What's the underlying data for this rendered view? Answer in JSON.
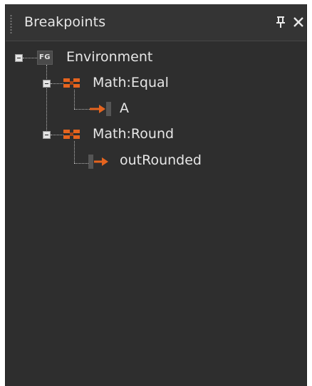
{
  "panel": {
    "title": "Breakpoints",
    "pin_glyph": "ф",
    "close_glyph": "✕"
  },
  "tree": {
    "root": {
      "icon": "flowgraph-icon",
      "icon_text": "FG",
      "label": "Environment",
      "expanded": true
    },
    "nodes": [
      {
        "icon": "node-icon",
        "label": "Math:Equal",
        "expanded": true,
        "ports": [
          {
            "icon": "input-port-arrow-icon",
            "label": "A"
          }
        ]
      },
      {
        "icon": "node-icon",
        "label": "Math:Round",
        "expanded": true,
        "ports": [
          {
            "icon": "output-port-arrow-icon",
            "label": "outRounded"
          }
        ]
      }
    ]
  },
  "colors": {
    "panel_bg": "#2e2e2e",
    "text": "#e6e6e6",
    "accent_orange": "#e5641f"
  }
}
